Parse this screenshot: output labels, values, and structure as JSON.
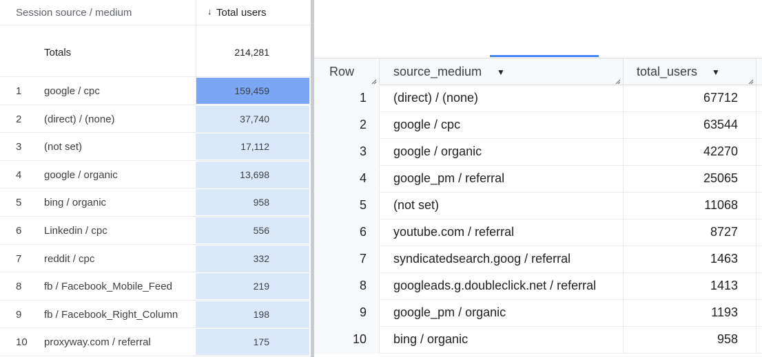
{
  "ga": {
    "dimension_header": "Session source / medium",
    "metric_header": "Total users",
    "sort_icon": "arrow-down-icon",
    "totals_label": "Totals",
    "totals_value": "214,281",
    "rows": [
      {
        "index": "1",
        "dimension": "google / cpc",
        "value": "159,459",
        "share": 1.0
      },
      {
        "index": "2",
        "dimension": "(direct) / (none)",
        "value": "37,740",
        "share": 0.237
      },
      {
        "index": "3",
        "dimension": "(not set)",
        "value": "17,112",
        "share": 0.107
      },
      {
        "index": "4",
        "dimension": "google / organic",
        "value": "13,698",
        "share": 0.086
      },
      {
        "index": "5",
        "dimension": "bing / organic",
        "value": "958",
        "share": 0.006
      },
      {
        "index": "6",
        "dimension": "Linkedin / cpc",
        "value": "556",
        "share": 0.003
      },
      {
        "index": "7",
        "dimension": "reddit / cpc",
        "value": "332",
        "share": 0.002
      },
      {
        "index": "8",
        "dimension": "fb / Facebook_Mobile_Feed",
        "value": "219",
        "share": 0.001
      },
      {
        "index": "9",
        "dimension": "fb / Facebook_Right_Column",
        "value": "198",
        "share": 0.001
      },
      {
        "index": "10",
        "dimension": "proxyway.com / referral",
        "value": "175",
        "share": 0.001
      }
    ],
    "colors": {
      "bar_strong": "#7ba6f5",
      "bar_light": "#dbe7fb"
    }
  },
  "bq": {
    "headers": {
      "row": "Row",
      "source_medium": "source_medium",
      "total_users": "total_users"
    },
    "rows": [
      {
        "row": "1",
        "source_medium": "(direct) / (none)",
        "total_users": "67712"
      },
      {
        "row": "2",
        "source_medium": "google / cpc",
        "total_users": "63544"
      },
      {
        "row": "3",
        "source_medium": "google / organic",
        "total_users": "42270"
      },
      {
        "row": "4",
        "source_medium": "google_pm / referral",
        "total_users": "25065"
      },
      {
        "row": "5",
        "source_medium": "(not set)",
        "total_users": "11068"
      },
      {
        "row": "6",
        "source_medium": "youtube.com / referral",
        "total_users": "8727"
      },
      {
        "row": "7",
        "source_medium": "syndicatedsearch.goog / referral",
        "total_users": "1463"
      },
      {
        "row": "8",
        "source_medium": "googleads.g.doubleclick.net / referral",
        "total_users": "1413"
      },
      {
        "row": "9",
        "source_medium": "google_pm / organic",
        "total_users": "1193"
      },
      {
        "row": "10",
        "source_medium": "bing / organic",
        "total_users": "958"
      }
    ],
    "accent": "#4285f4"
  }
}
